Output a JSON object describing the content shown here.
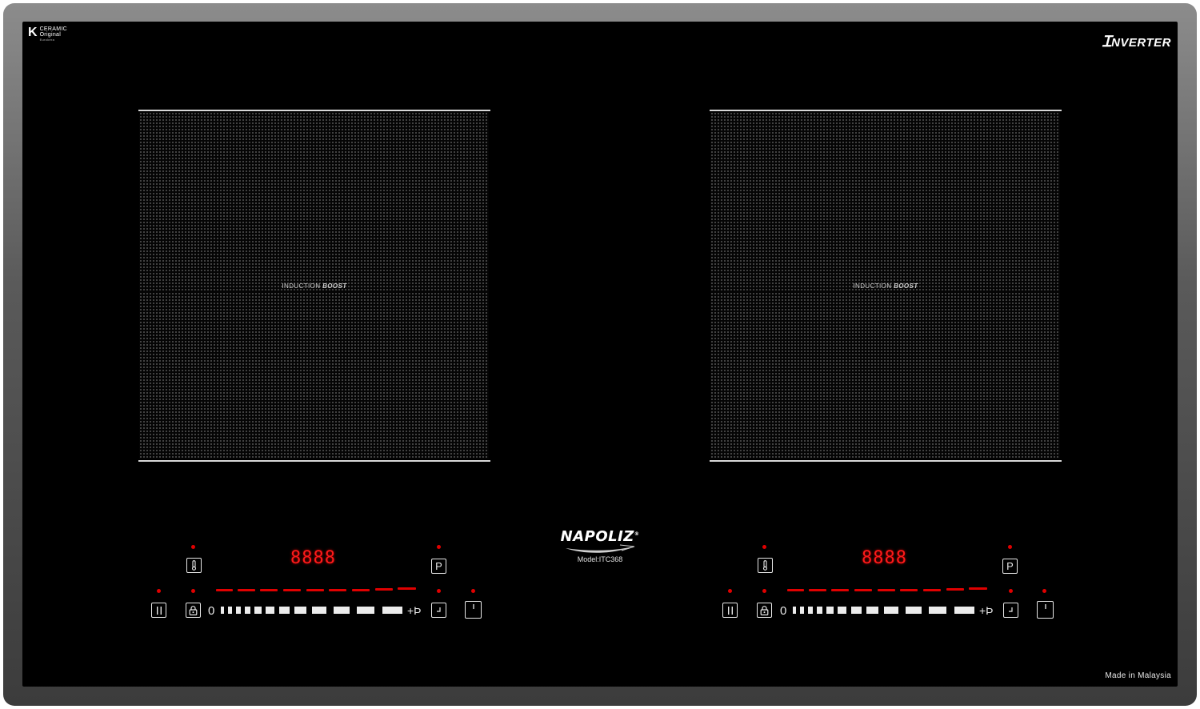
{
  "glass": {
    "badge": {
      "letter": "K",
      "line1": "CERAMIC",
      "line2": "Original",
      "line3": "Eurokera"
    },
    "inverter_label": "NVERTER",
    "made_in": "Made in Malaysia"
  },
  "brand": {
    "name": "NAPOLIZ",
    "mark": "®",
    "model": "Model:ITC368"
  },
  "zones": [
    {
      "label_plain": "INDUCTION",
      "label_bold": "BOOST"
    },
    {
      "label_plain": "INDUCTION",
      "label_bold": "BOOST"
    }
  ],
  "controls": [
    {
      "display": "8888",
      "zero": "0",
      "plus_p": "+Þ",
      "pause_icon": "pause-icon",
      "lock_icon": "lock-icon",
      "temp_icon": "thermometer-icon",
      "program_label": "P",
      "timer_icon": "timer-icon",
      "power_icon": "power-icon"
    },
    {
      "display": "8888",
      "zero": "0",
      "plus_p": "+Þ",
      "pause_icon": "pause-icon",
      "lock_icon": "lock-icon",
      "temp_icon": "thermometer-icon",
      "program_label": "P",
      "timer_icon": "timer-icon",
      "power_icon": "power-icon"
    }
  ],
  "colors": {
    "frame": "#5a5a5a",
    "glass": "#000000",
    "indicator": "#e00000",
    "symbols": "#e8e8e8"
  }
}
